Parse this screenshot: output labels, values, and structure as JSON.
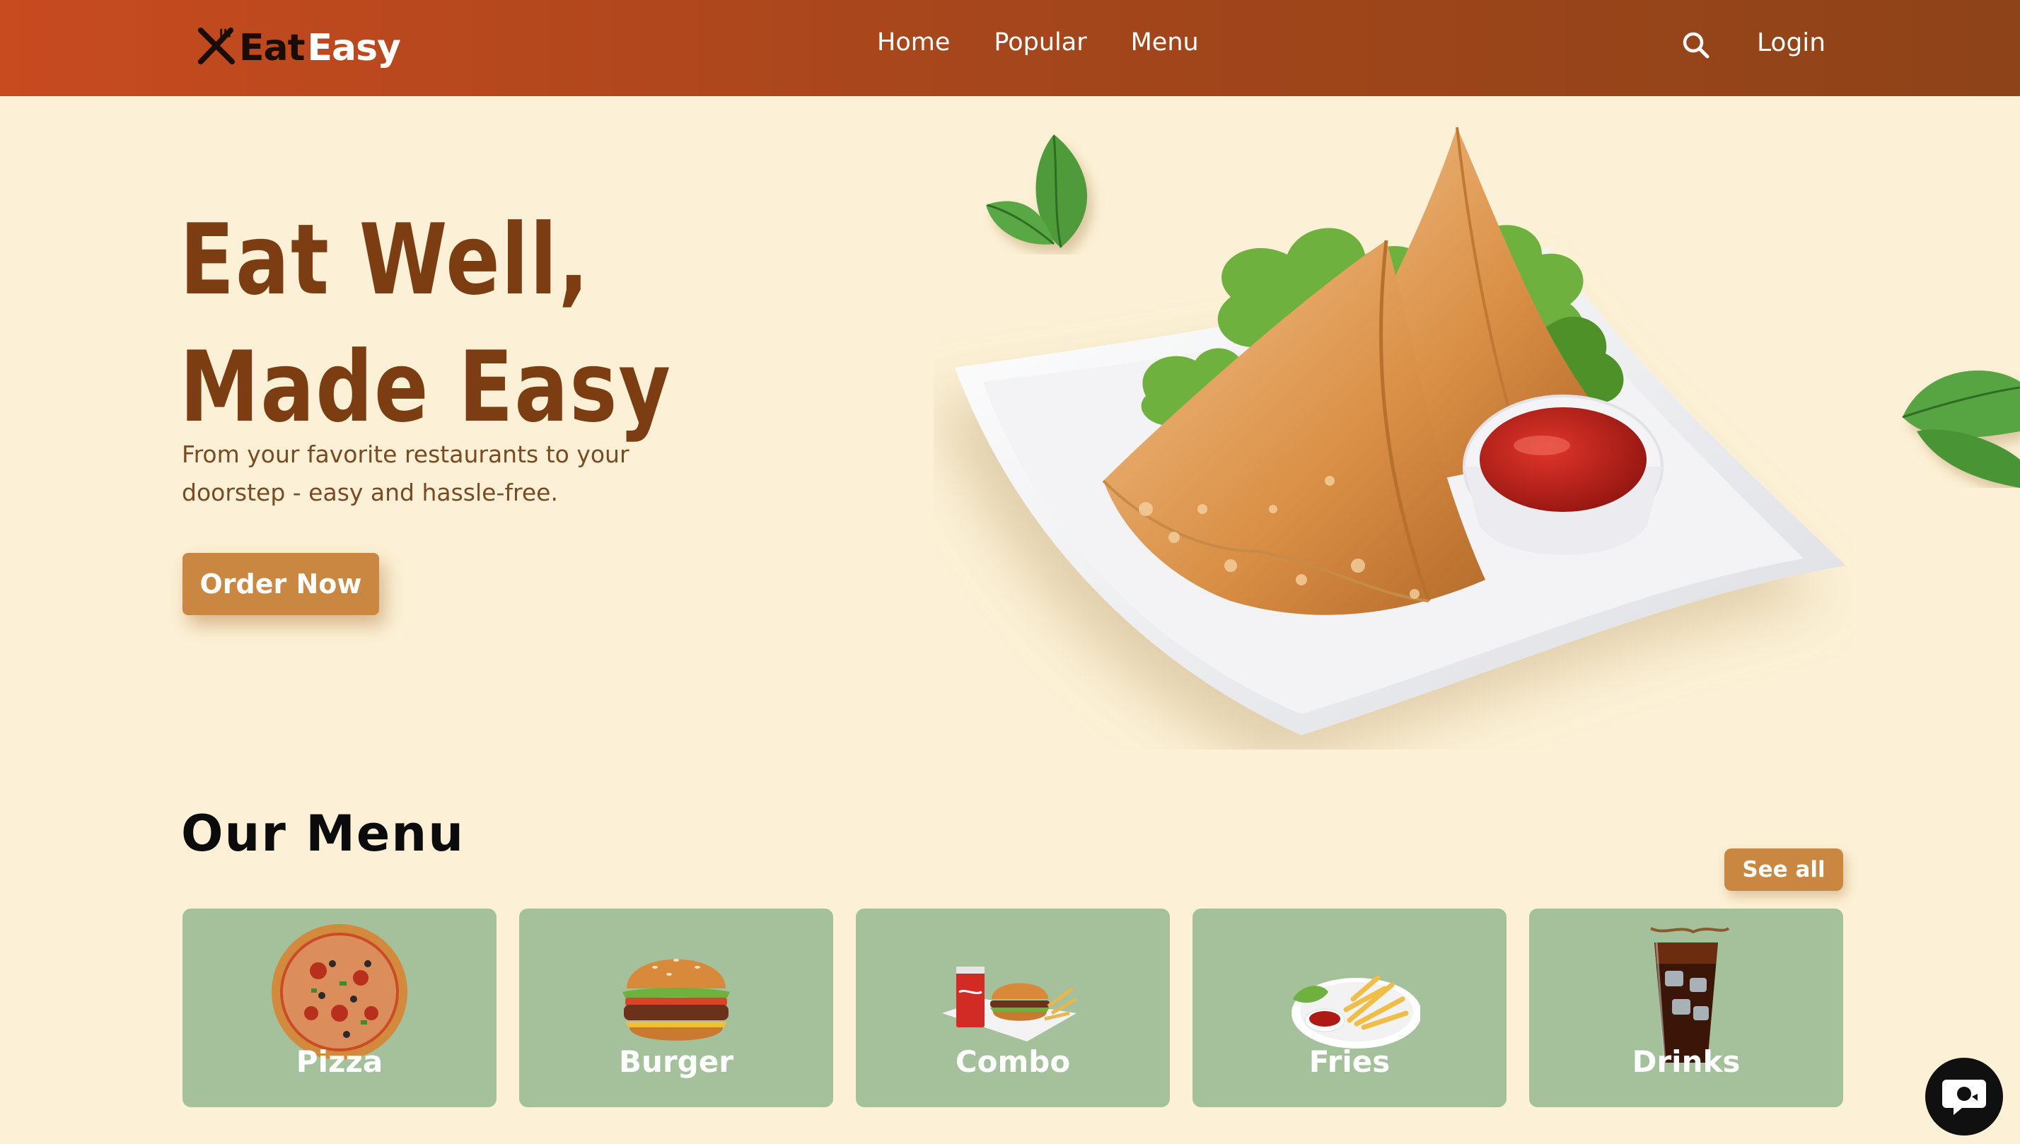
{
  "brand": {
    "eat": "Eat",
    "easy": "Easy",
    "icon": "fork-knife-icon"
  },
  "nav": {
    "links": [
      "Home",
      "Popular",
      "Menu"
    ],
    "login": "Login",
    "search_icon": "search-icon"
  },
  "hero": {
    "title_line1": "Eat Well,",
    "title_line2": "Made Easy",
    "subtitle_line1": "From your favorite restaurants to your",
    "subtitle_line2": "doorstep - easy and hassle-free.",
    "cta": "Order Now"
  },
  "menu": {
    "title": "Our Menu",
    "see_all": "See all",
    "categories": [
      "Pizza",
      "Burger",
      "Combo",
      "Fries",
      "Drinks"
    ]
  },
  "colors": {
    "nav_start": "#c84a1f",
    "nav_end": "#8e4318",
    "background": "#fcf1d6",
    "title": "#7c3d12",
    "accent": "#c98742",
    "card": "#a4c19c"
  },
  "chat": {
    "icon": "chat-icon"
  }
}
